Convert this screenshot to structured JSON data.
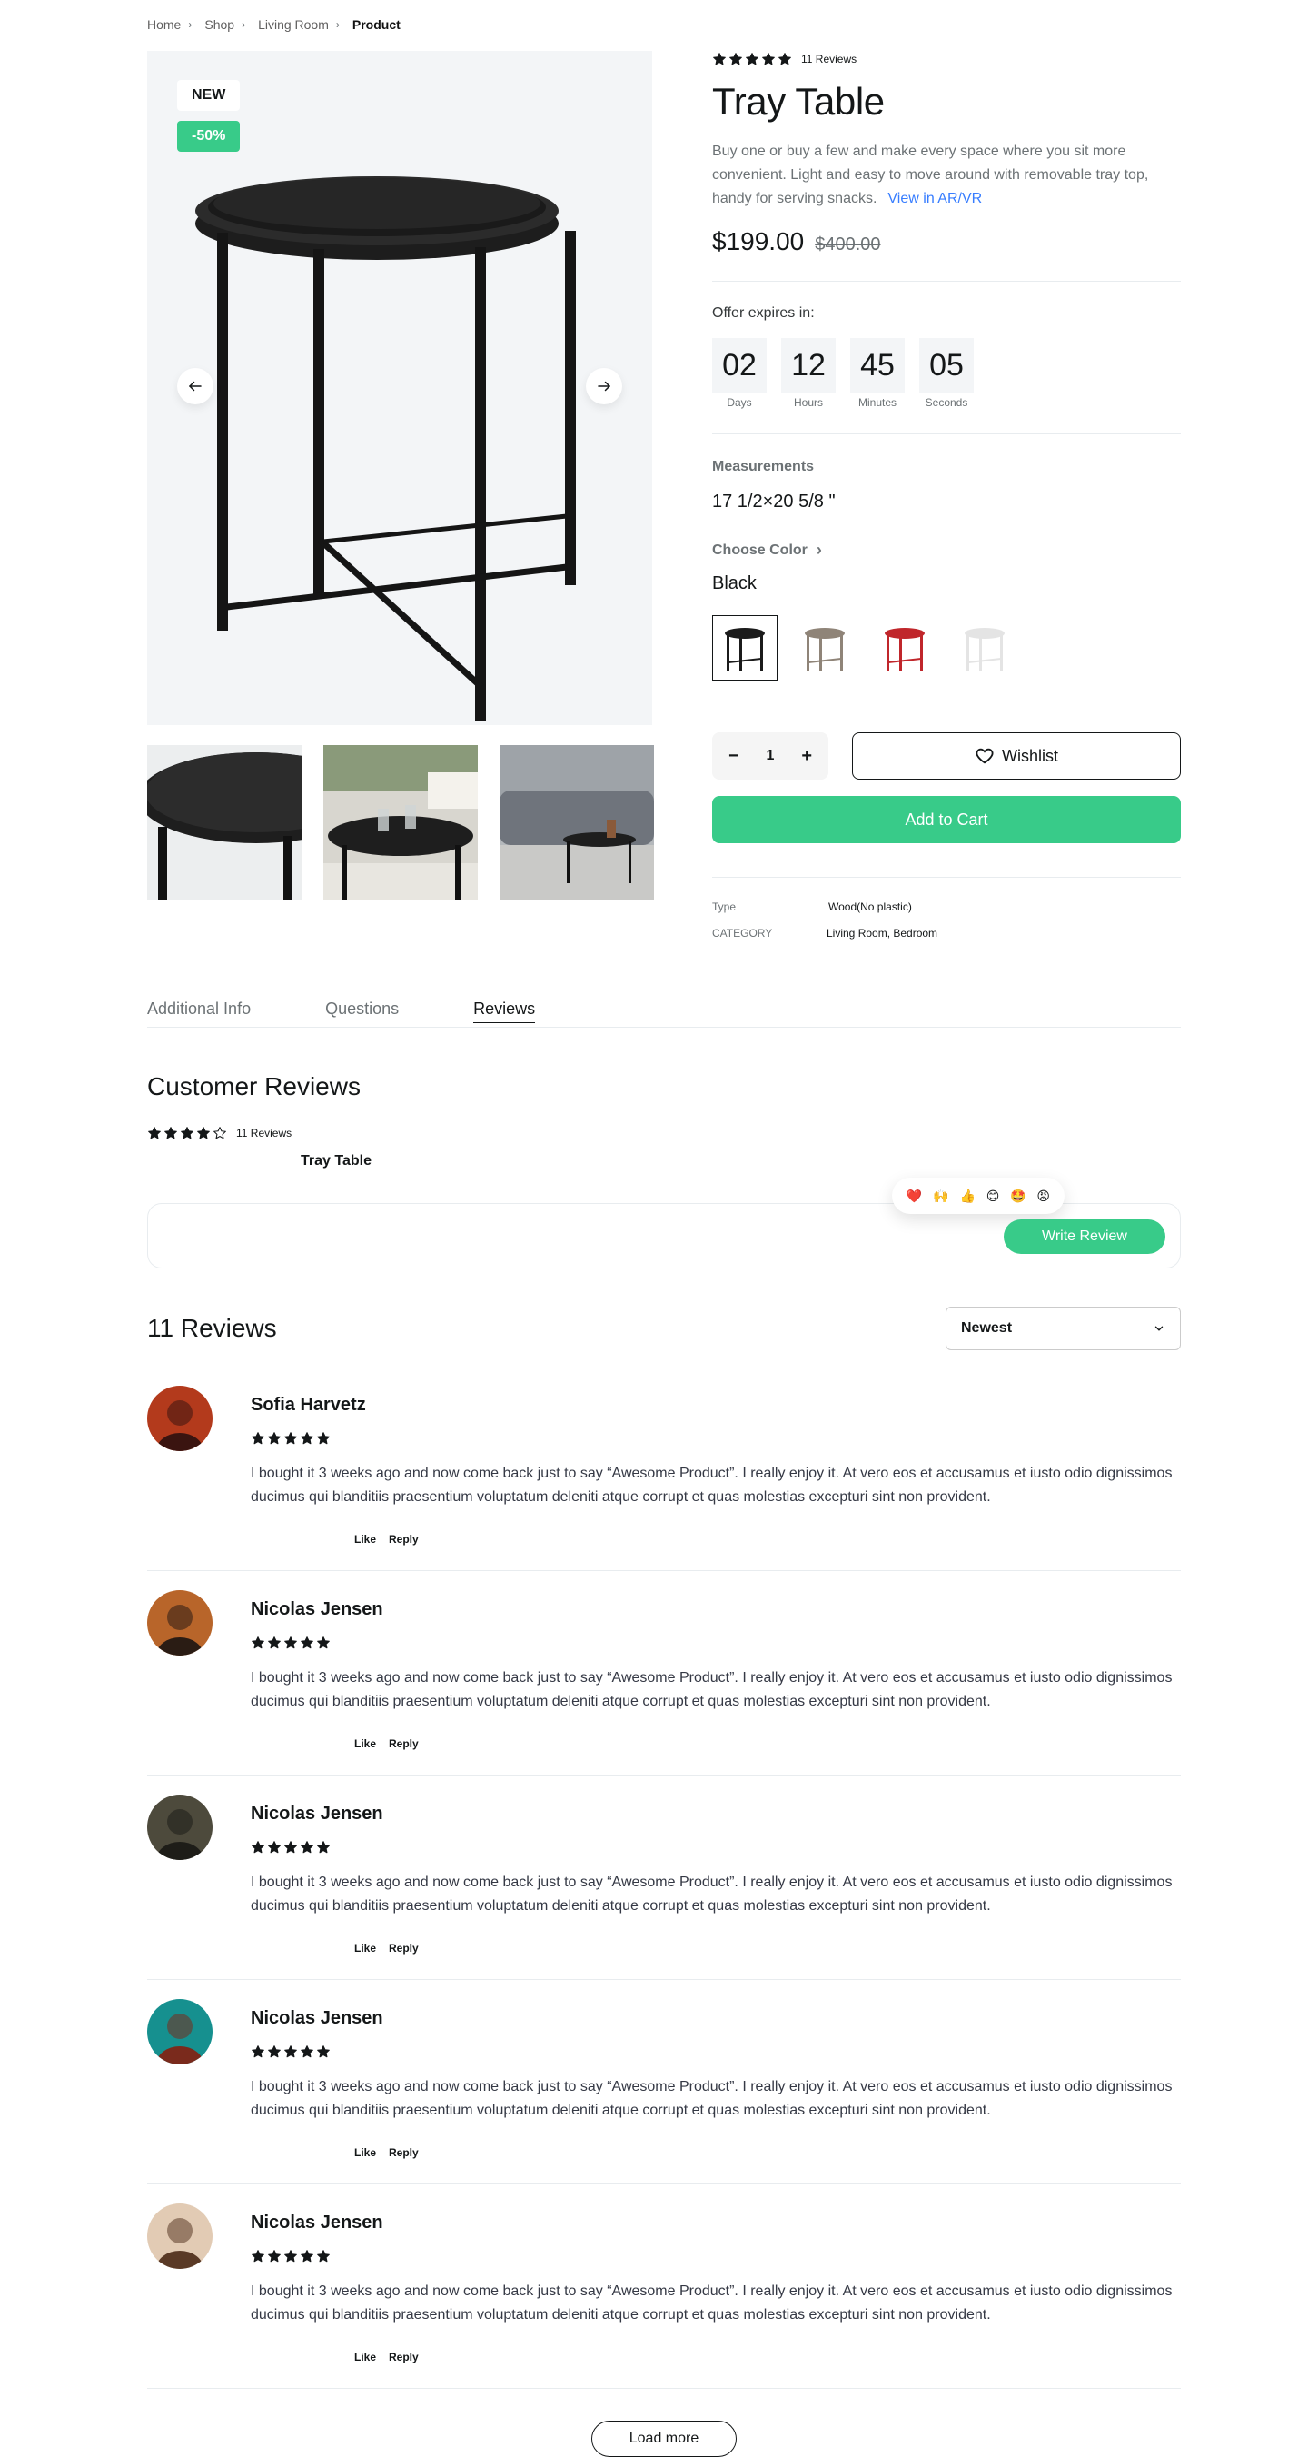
{
  "breadcrumb": [
    "Home",
    "Shop",
    "Living Room",
    "Product"
  ],
  "gallery": {
    "badge_new": "NEW",
    "badge_sale": "-50%"
  },
  "product": {
    "review_count_label": "11 Reviews",
    "rating": 5,
    "title": "Tray Table",
    "description": "Buy one or buy a few and make every space where you sit more convenient. Light and easy to move around with removable tray top, handy for serving snacks.",
    "ar_link": "View in AR/VR",
    "price": "$199.00",
    "old_price": "$400.00"
  },
  "offer": {
    "label": "Offer expires in:",
    "units": [
      {
        "value": "02",
        "caption": "Days"
      },
      {
        "value": "12",
        "caption": "Hours"
      },
      {
        "value": "45",
        "caption": "Minutes"
      },
      {
        "value": "05",
        "caption": "Seconds"
      }
    ]
  },
  "measurements": {
    "label": "Measurements",
    "value": "17 1/2×20 5/8 \""
  },
  "color": {
    "label": "Choose Color",
    "value": "Black",
    "swatches": [
      "#1b1b1b",
      "#8f8478",
      "#c0262b",
      "#e4e4e4"
    ]
  },
  "cart": {
    "quantity": "1",
    "wishlist": "Wishlist",
    "add_to_cart": "Add to Cart"
  },
  "meta": {
    "type_key": "Type",
    "type_value": "Wood(No plastic)",
    "category_key": "CATEGORY",
    "category_value": "Living Room, Bedroom"
  },
  "tabs": [
    "Additional Info",
    "Questions",
    "Reviews"
  ],
  "customer_reviews": {
    "title": "Customer Reviews",
    "rating": 4,
    "count_label": "11 Reviews",
    "product_name": "Tray Table",
    "write_review": "Write Review",
    "emojis": [
      "❤️",
      "🙌",
      "👍",
      "😊",
      "🤩",
      "😡"
    ]
  },
  "reviews_header": {
    "count": "11 Reviews",
    "sort": "Newest"
  },
  "reviews": [
    {
      "name": "Sofia Harvetz",
      "text": "I bought it 3 weeks ago and now come back just to say “Awesome Product”. I really enjoy it. At vero eos et accusamus et iusto odio dignissimos ducimus qui blanditiis praesentium voluptatum deleniti atque corrupt et quas molestias excepturi sint non provident.",
      "like": "Like",
      "reply": "Reply",
      "avatar_colors": [
        "#b33a1c",
        "#3a1410"
      ]
    },
    {
      "name": "Nicolas Jensen",
      "text": "I bought it 3 weeks ago and now come back just to say “Awesome Product”. I really enjoy it. At vero eos et accusamus et iusto odio dignissimos ducimus qui blanditiis praesentium voluptatum deleniti atque corrupt et quas molestias excepturi sint non provident.",
      "like": "Like",
      "reply": "Reply",
      "avatar_colors": [
        "#b8652a",
        "#2a1c14"
      ]
    },
    {
      "name": "Nicolas Jensen",
      "text": "I bought it 3 weeks ago and now come back just to say “Awesome Product”. I really enjoy it. At vero eos et accusamus et iusto odio dignissimos ducimus qui blanditiis praesentium voluptatum deleniti atque corrupt et quas molestias excepturi sint non provident.",
      "like": "Like",
      "reply": "Reply",
      "avatar_colors": [
        "#4d4a3c",
        "#1e1d18"
      ]
    },
    {
      "name": "Nicolas Jensen",
      "text": "I bought it 3 weeks ago and now come back just to say “Awesome Product”. I really enjoy it. At vero eos et accusamus et iusto odio dignissimos ducimus qui blanditiis praesentium voluptatum deleniti atque corrupt et quas molestias excepturi sint non provident.",
      "like": "Like",
      "reply": "Reply",
      "avatar_colors": [
        "#16908f",
        "#7a2a1c"
      ]
    },
    {
      "name": "Nicolas Jensen",
      "text": "I bought it 3 weeks ago and now come back just to say “Awesome Product”. I really enjoy it. At vero eos et accusamus et iusto odio dignissimos ducimus qui blanditiis praesentium voluptatum deleniti atque corrupt et quas molestias excepturi sint non provident.",
      "like": "Like",
      "reply": "Reply",
      "avatar_colors": [
        "#e2cbb4",
        "#5a3a26"
      ]
    }
  ],
  "load_more": "Load more",
  "colors": {
    "accent": "#38cb89",
    "text": "#141718",
    "muted": "#6c7275",
    "link": "#377dff"
  }
}
